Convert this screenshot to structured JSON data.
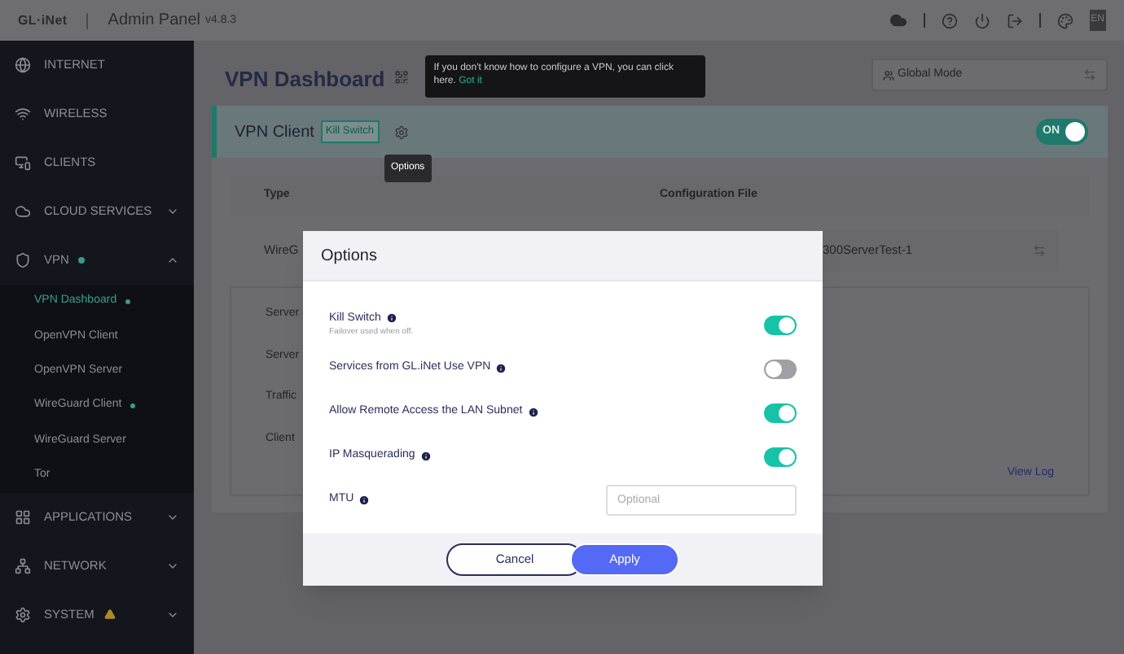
{
  "header": {
    "logo": "GL·iNet",
    "title": "Admin Panel",
    "version": "v4.8.3",
    "language": "EN"
  },
  "sidebar": {
    "items": [
      {
        "label": "INTERNET"
      },
      {
        "label": "WIRELESS"
      },
      {
        "label": "CLIENTS"
      },
      {
        "label": "CLOUD SERVICES",
        "expanded": false
      },
      {
        "label": "VPN",
        "expanded": true,
        "dot": true,
        "children": [
          {
            "label": "VPN Dashboard",
            "selected": true,
            "dot": true
          },
          {
            "label": "OpenVPN Client",
            "selected": false,
            "dot": false
          },
          {
            "label": "OpenVPN Server",
            "selected": false,
            "dot": false
          },
          {
            "label": "WireGuard Client",
            "selected": false,
            "dot": true
          },
          {
            "label": "WireGuard Server",
            "selected": false,
            "dot": false
          },
          {
            "label": "Tor",
            "selected": false,
            "dot": false
          }
        ]
      },
      {
        "label": "APPLICATIONS",
        "expanded": false
      },
      {
        "label": "NETWORK",
        "expanded": false
      },
      {
        "label": "SYSTEM",
        "expanded": false,
        "warning": true
      }
    ]
  },
  "main": {
    "title": "VPN Dashboard",
    "tooltip": {
      "text": "If you don't know how to configure a VPN, you can click here.",
      "link": "Got it"
    },
    "mode": "Global Mode",
    "card": {
      "title": "VPN Client",
      "badge": "Kill Switch",
      "options_tooltip": "Options",
      "toggle": {
        "label": "ON",
        "on": true
      },
      "columns": [
        "Type",
        "Configuration File"
      ],
      "row": [
        "WireG",
        "300ServerTest-1"
      ],
      "details": [
        "Server",
        "Server",
        "Traffic",
        "Client"
      ],
      "link": "View Log"
    }
  },
  "modal": {
    "title": "Options",
    "options": [
      {
        "label": "Kill Switch",
        "hint": "Failover used when off.",
        "on": true
      },
      {
        "label": "Services from GL.iNet Use VPN",
        "on": false
      },
      {
        "label": "Allow Remote Access the LAN Subnet",
        "on": true
      },
      {
        "label": "IP Masquerading",
        "on": true
      }
    ],
    "mtu": {
      "label": "MTU",
      "placeholder": "Optional"
    },
    "buttons": [
      "Cancel",
      "Apply"
    ]
  }
}
